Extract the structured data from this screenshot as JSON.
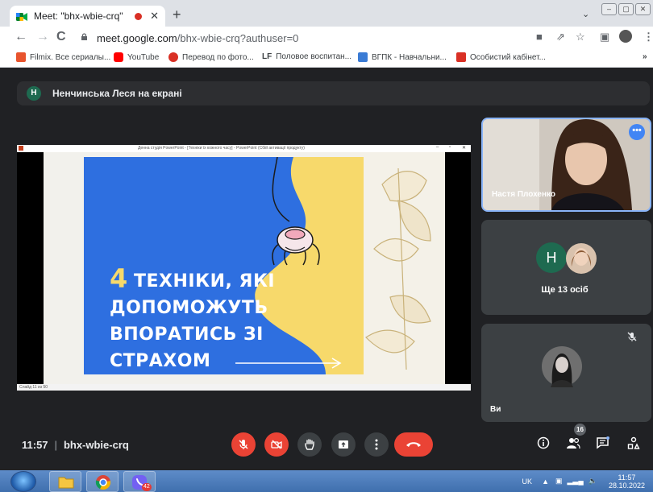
{
  "browser": {
    "tab_title": "Meet: \"bhx-wbie-crq\"",
    "url_host": "meet.google.com",
    "url_path": "/bhx-wbie-crq?authuser=0",
    "bookmarks": [
      {
        "label": "Filmix. Все сериалы...",
        "icon": "filmix-icon",
        "color": "#e8542d"
      },
      {
        "label": "YouTube",
        "icon": "youtube-icon",
        "color": "#ff0000"
      },
      {
        "label": "Перевод по фото...",
        "icon": "translate-photo-icon",
        "color": "#d93025"
      },
      {
        "label": "Половое воспитан...",
        "icon": "lf-icon",
        "color": "#1a1a1a"
      },
      {
        "label": "ВГПК - Навчальни...",
        "icon": "vgpk-icon",
        "color": "#3a7bd5"
      },
      {
        "label": "Особистий кабінет...",
        "icon": "cabinet-icon",
        "color": "#d93025"
      }
    ],
    "bookmarks_overflow": "»"
  },
  "meet": {
    "presenter_initial": "Н",
    "presenter_banner": "Ненчинська Леся на екрані",
    "share_window_title": "Денна студія PowerPoint - [Техніки їх кожного часу] - PowerPoint (Сбій активації продукту)",
    "share_status": "Слайд 11 из 50",
    "slide": {
      "number_glyph": "4",
      "lines": [
        "ТЕХНІКИ, ЯКІ",
        "ДОПОМОЖУТЬ",
        "ВПОРАТИСЬ ЗІ",
        "СТРАХОМ"
      ]
    },
    "tiles": [
      {
        "name": "Настя Плохенко",
        "more_icon": "more-options-icon"
      },
      {
        "initial": "Н",
        "initial_color": "#1e6a50",
        "label": "Ще 13 осіб"
      },
      {
        "name": "Ви",
        "muted_icon": "mic-off-icon"
      }
    ],
    "controls": {
      "time": "11:57",
      "meeting_code": "bhx-wbie-crq",
      "people_count": "16"
    }
  },
  "taskbar": {
    "lang": "UK",
    "time": "11:57",
    "date": "28.10.2022",
    "viber_badge": "42"
  }
}
